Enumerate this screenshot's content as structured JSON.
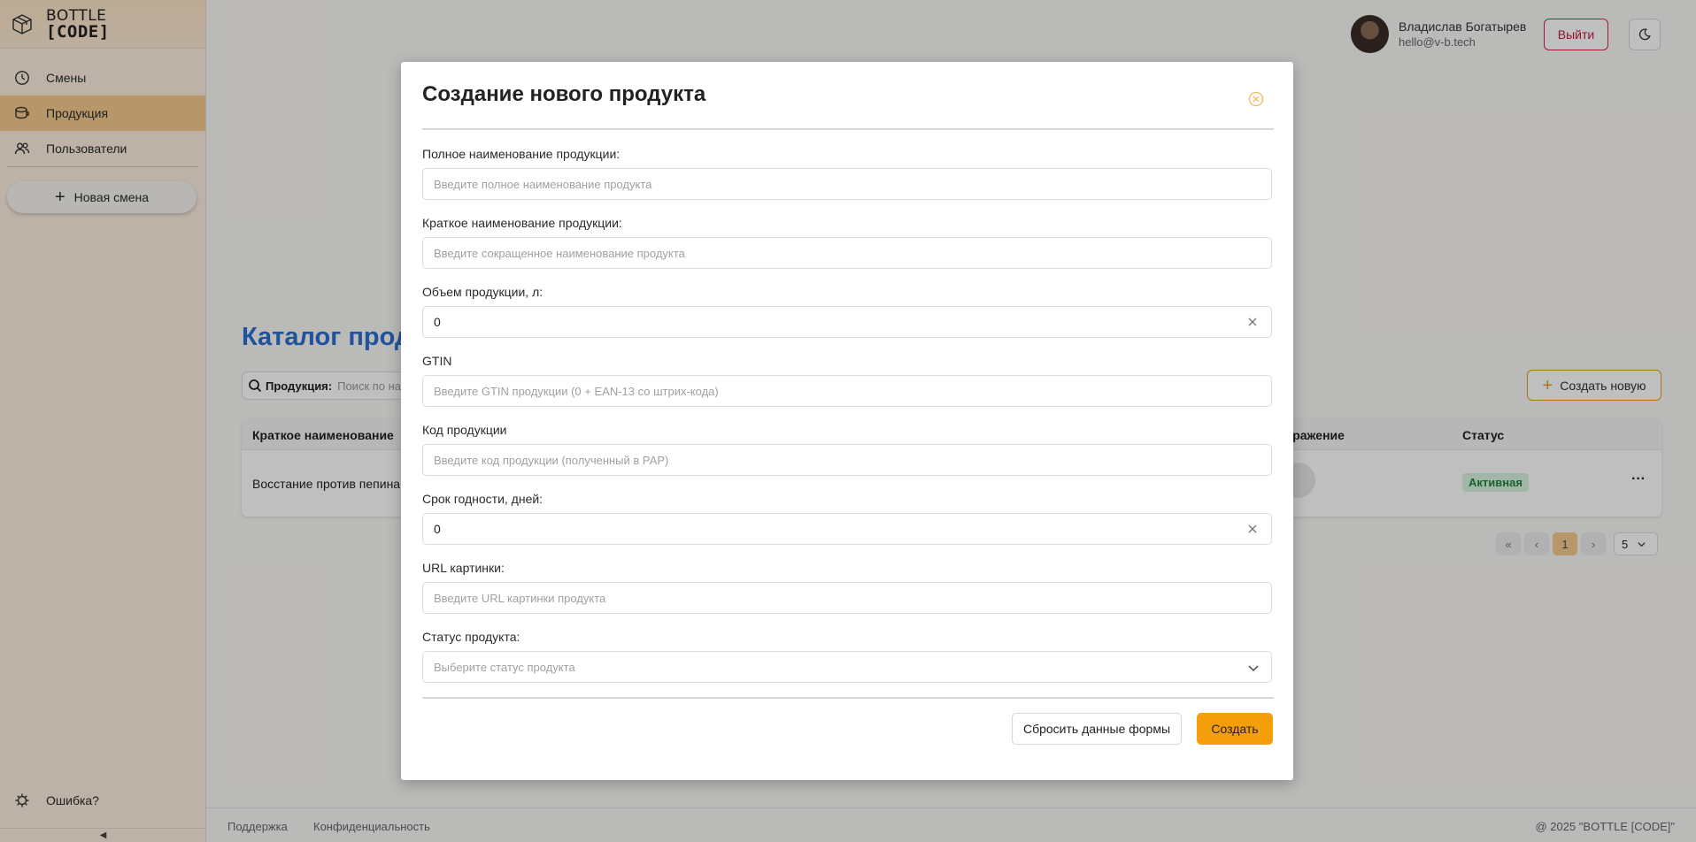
{
  "brand": {
    "line1": "BOTTLE",
    "line2": "[CODE]"
  },
  "sidebar": {
    "items": [
      {
        "label": "Смены",
        "icon": "clock-icon"
      },
      {
        "label": "Продукция",
        "icon": "bottle-icon"
      },
      {
        "label": "Пользователи",
        "icon": "users-icon"
      }
    ],
    "new_shift": "Новая смена",
    "error_link": "Ошибка?",
    "collapse": "◀"
  },
  "header": {
    "user_name": "Владислав Богатырев",
    "user_email": "hello@v-b.tech",
    "logout": "Выйти"
  },
  "main": {
    "title": "Каталог прод",
    "search_label": "Продукция:",
    "search_placeholder": "Поиск по на",
    "create_new": "Создать новую",
    "table": {
      "headers": [
        "Краткое наименование",
        "ображение",
        "Статус"
      ],
      "rows": [
        {
          "name": "Восстание против пепина",
          "status": "Активная",
          "actions": "···"
        }
      ]
    },
    "pagination": {
      "first": "«",
      "prev": "‹",
      "current": "1",
      "next": "›",
      "page_size": "5"
    }
  },
  "footer": {
    "support": "Поддержка",
    "privacy": "Конфиденциальность",
    "copyright": "@ 2025 \"BOTTLE [CODE]\""
  },
  "modal": {
    "title": "Создание нового продукта",
    "fields": [
      {
        "label": "Полное наименование продукции:",
        "placeholder": "Введите полное наименование продукта",
        "value": ""
      },
      {
        "label": "Краткое наименование продукции:",
        "placeholder": "Введите сокращенное наименование продукта",
        "value": ""
      },
      {
        "label": "Объем продукции, л:",
        "placeholder": "",
        "value": "0"
      },
      {
        "label": "GTIN",
        "placeholder": "Введите GTIN продукции (0 + EAN-13 со штрих-кода)",
        "value": ""
      },
      {
        "label": "Код продукции",
        "placeholder": "Введите код продукции (полученный в РАР)",
        "value": ""
      },
      {
        "label": "Срок годности, дней:",
        "placeholder": "",
        "value": "0"
      },
      {
        "label": "URL картинки:",
        "placeholder": "Введите URL картинки продукта",
        "value": ""
      },
      {
        "label": "Статус продукта:",
        "placeholder": "Выберите статус продукта",
        "value": ""
      }
    ],
    "reset": "Сбросить данные формы",
    "submit": "Создать"
  },
  "colors": {
    "accent": "#f59e0b",
    "sidebar_active": "#f5c98d",
    "logout": "#c8183f",
    "title_blue": "#2a6fd2",
    "status_active": "#22833b"
  }
}
